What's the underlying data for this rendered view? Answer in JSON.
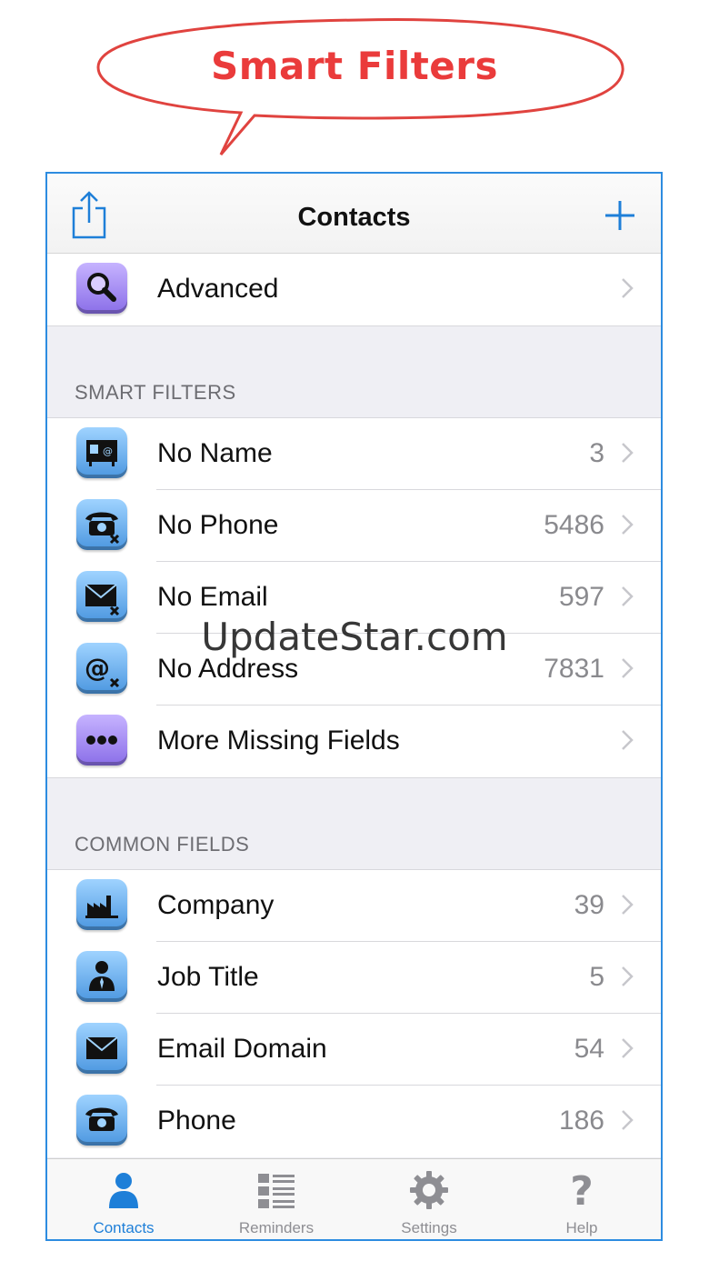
{
  "banner": {
    "title": "Smart Filters"
  },
  "navbar": {
    "title": "Contacts",
    "left_icon": "share-icon",
    "right_icon": "plus-icon"
  },
  "top_group": [
    {
      "label": "Advanced",
      "count": "",
      "icon": "magnifier-icon"
    }
  ],
  "smart_filters": {
    "header": "SMART FILTERS",
    "items": [
      {
        "label": "No Name",
        "count": "3",
        "icon": "no-name-card-icon"
      },
      {
        "label": "No Phone",
        "count": "5486",
        "icon": "no-phone-icon"
      },
      {
        "label": "No Email",
        "count": "597",
        "icon": "no-email-icon"
      },
      {
        "label": "No Address",
        "count": "7831",
        "icon": "no-address-icon"
      },
      {
        "label": "More Missing Fields",
        "count": "",
        "icon": "more-dots-icon"
      }
    ]
  },
  "common_fields": {
    "header": "COMMON FIELDS",
    "items": [
      {
        "label": "Company",
        "count": "39",
        "icon": "factory-icon"
      },
      {
        "label": "Job Title",
        "count": "5",
        "icon": "person-tie-icon"
      },
      {
        "label": "Email Domain",
        "count": "54",
        "icon": "envelope-icon"
      },
      {
        "label": "Phone",
        "count": "186",
        "icon": "phone-icon"
      }
    ]
  },
  "watermark": "UpdateStar.com",
  "tabbar": {
    "tabs": [
      {
        "label": "Contacts",
        "icon": "person-icon",
        "active": true
      },
      {
        "label": "Reminders",
        "icon": "list-icon",
        "active": false
      },
      {
        "label": "Settings",
        "icon": "gear-icon",
        "active": false
      },
      {
        "label": "Help",
        "icon": "question-icon",
        "active": false
      }
    ]
  },
  "colors": {
    "accent": "#1e7fd8",
    "banner_red": "#ea3b3b",
    "frame_blue": "#2d8ce0"
  }
}
